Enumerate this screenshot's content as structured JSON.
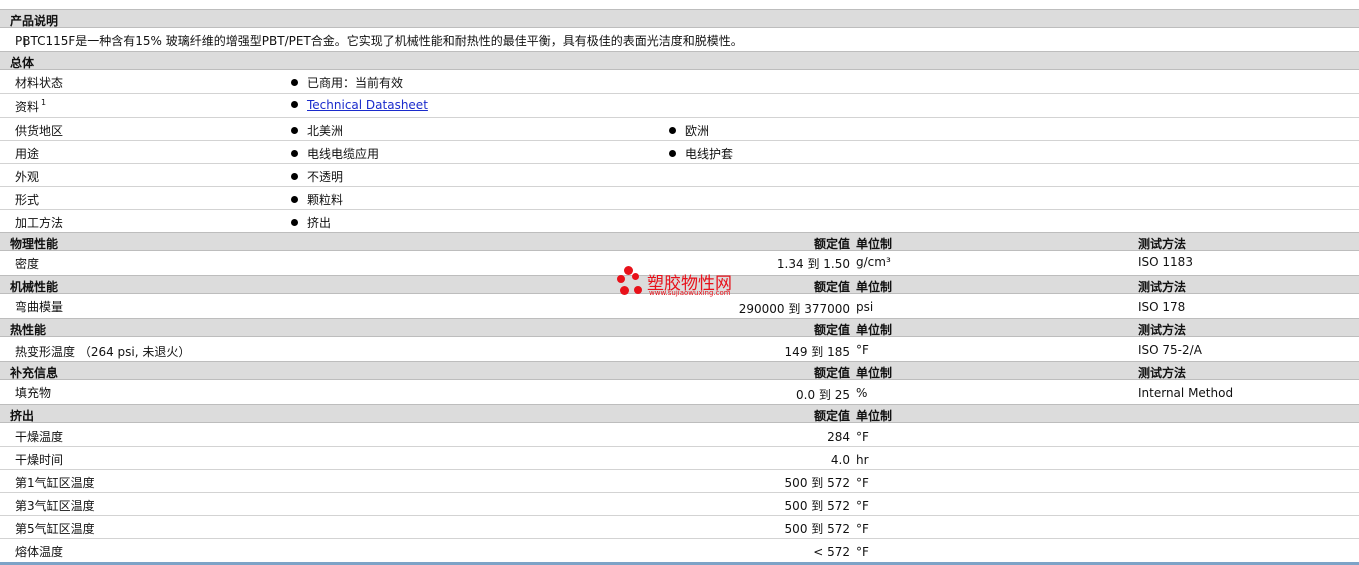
{
  "sections": {
    "description": {
      "title": "产品说明",
      "text": "PBTC115F是一种含有15% 玻璃纤维的增强型PBT/PET合金。它实现了机械性能和耐热性的最佳平衡，具有极佳的表面光洁度和脱模性。"
    },
    "general": {
      "title": "总体",
      "rows": [
        {
          "label": "材料状态",
          "items": [
            "已商用：当前有效"
          ]
        },
        {
          "label": "资料",
          "sup": "1",
          "link": "Technical Datasheet"
        },
        {
          "label": "供货地区",
          "items": [
            "北美洲",
            "欧洲"
          ]
        },
        {
          "label": "用途",
          "items": [
            "电线电缆应用",
            "电线护套"
          ]
        },
        {
          "label": "外观",
          "items": [
            "不透明"
          ]
        },
        {
          "label": "形式",
          "items": [
            "颗粒料"
          ]
        },
        {
          "label": "加工方法",
          "items": [
            "挤出"
          ]
        }
      ]
    },
    "headers": {
      "nominal": "额定值",
      "unit": "单位制",
      "method": "测试方法"
    },
    "physical": {
      "title": "物理性能",
      "rows": [
        {
          "label": "密度",
          "value": "1.34 到  1.50",
          "unit": "g/cm³",
          "method": "ISO 1183"
        }
      ]
    },
    "mechanical": {
      "title": "机械性能",
      "rows": [
        {
          "label": "弯曲模量",
          "value": "290000 到  377000",
          "unit": "psi",
          "method": "ISO 178"
        }
      ]
    },
    "thermal": {
      "title": "热性能",
      "rows": [
        {
          "label": "热变形温度 （264 psi, 未退火）",
          "value": "149 到  185",
          "unit": "°F",
          "method": "ISO 75-2/A"
        }
      ]
    },
    "supplemental": {
      "title": "补充信息",
      "rows": [
        {
          "label": "填充物",
          "value": "0.0 到  25",
          "unit": "%",
          "method": "Internal Method"
        }
      ]
    },
    "extrusion": {
      "title": "挤出",
      "rows": [
        {
          "label": "干燥温度",
          "value": "284",
          "unit": "°F"
        },
        {
          "label": "干燥时间",
          "value": "4.0",
          "unit": "hr"
        },
        {
          "label": "第1气缸区温度",
          "value": "500 到  572",
          "unit": "°F"
        },
        {
          "label": "第3气缸区温度",
          "value": "500 到  572",
          "unit": "°F"
        },
        {
          "label": "第5气缸区温度",
          "value": "500 到  572",
          "unit": "°F"
        },
        {
          "label": "熔体温度",
          "value": "< 572",
          "unit": "°F"
        }
      ]
    }
  },
  "watermark": {
    "name": "塑胶物性网",
    "url": "www.sujiaowuxing.com"
  },
  "colors": {
    "section_bg": "#dcdcdc",
    "link": "#1a2bcc",
    "watermark": "#e8111a"
  }
}
